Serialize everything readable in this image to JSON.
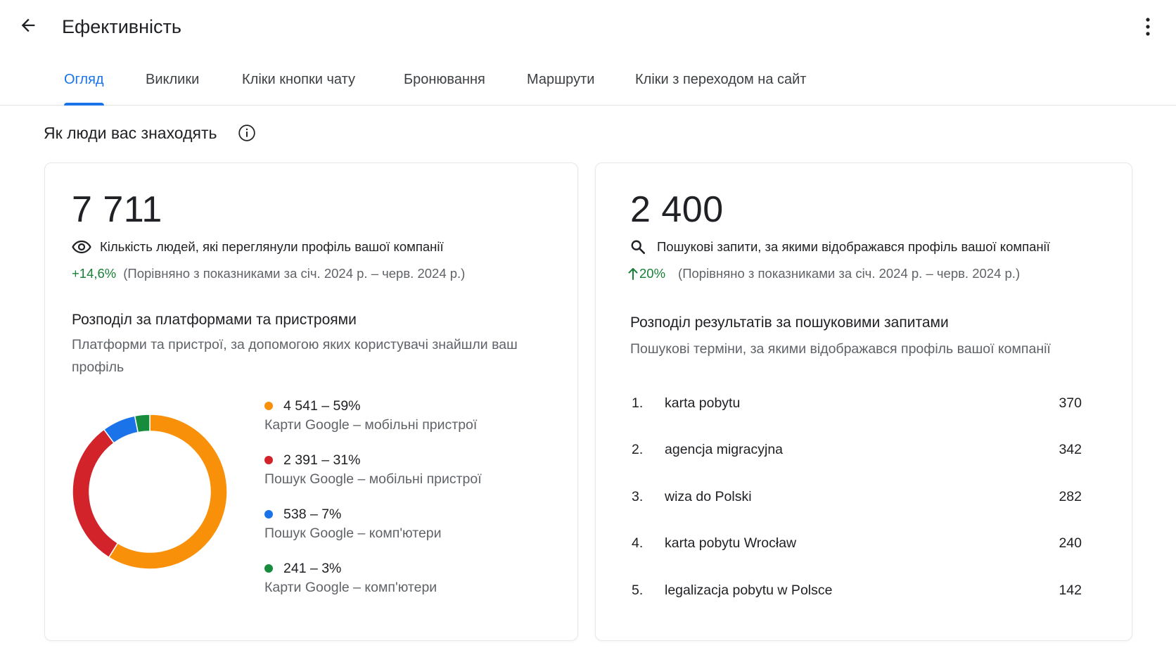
{
  "header": {
    "title": "Ефективність",
    "back_icon": "arrow-back-icon",
    "more_icon": "more-vert-icon"
  },
  "tabs": [
    {
      "label": "Огляд",
      "active": true
    },
    {
      "label": "Виклики",
      "active": false
    },
    {
      "label": "Кліки кнопки чату",
      "active": false
    },
    {
      "label": "Бронювання",
      "active": false
    },
    {
      "label": "Маршрути",
      "active": false
    },
    {
      "label": "Кліки з переходом на сайт",
      "active": false
    }
  ],
  "section": {
    "title": "Як люди вас знаходять",
    "info_icon": "info-icon"
  },
  "profile_views": {
    "total": "7 711",
    "label": "Кількість людей, які переглянули профіль вашої компанії",
    "icon": "eye-icon",
    "delta": "+14,6%",
    "comparison": "(Порівняно з показниками за січ. 2024 р. – черв. 2024 р.)",
    "breakdown_title": "Розподіл за платформами та пристроями",
    "breakdown_desc": "Платформи та пристрої, за допомогою яких користувачі знайшли ваш профіль"
  },
  "searches": {
    "total": "2 400",
    "label": "Пошукові запити, за якими відображався профіль вашої компанії",
    "icon": "search-icon",
    "delta": "20%",
    "delta_icon": "arrow-up-icon",
    "comparison": "(Порівняно з показниками за січ. 2024 р. – черв. 2024 р.)",
    "breakdown_title": "Розподіл результатів за пошуковими запитами",
    "breakdown_desc": "Пошукові терміни, за якими відображався профіль вашої компанії",
    "queries": [
      {
        "rank": "1.",
        "term": "karta pobytu",
        "count": "370"
      },
      {
        "rank": "2.",
        "term": "agencja migracyjna",
        "count": "342"
      },
      {
        "rank": "3.",
        "term": "wiza do Polski",
        "count": "282"
      },
      {
        "rank": "4.",
        "term": "karta pobytu Wrocław",
        "count": "240"
      },
      {
        "rank": "5.",
        "term": "legalizacja pobytu w Polsce",
        "count": "142"
      }
    ]
  },
  "chart_data": {
    "type": "pie",
    "categories": [
      "Карти Google – мобільні пристрої",
      "Пошук Google – мобільні пристрої",
      "Пошук Google – комп'ютери",
      "Карти Google – комп'ютери"
    ],
    "values": [
      4541,
      2391,
      538,
      241
    ],
    "value_labels": [
      "4 541 – 59%",
      "2 391 – 31%",
      "538 – 7%",
      "241 – 3%"
    ],
    "colors": [
      "#f9900a",
      "#d3232a",
      "#1a73e8",
      "#168c3c"
    ]
  }
}
